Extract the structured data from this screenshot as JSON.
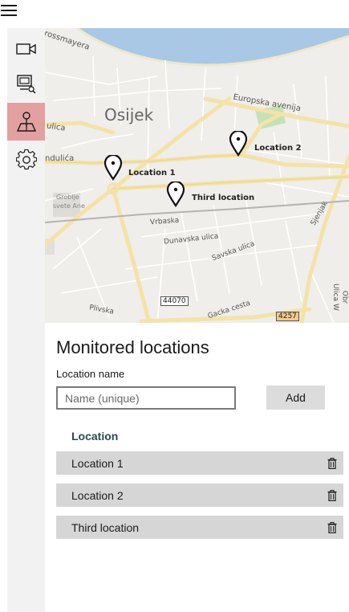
{
  "nav": {
    "items": [
      {
        "id": "cameras",
        "icon": "video-camera-icon",
        "selected": false
      },
      {
        "id": "monitor-search",
        "icon": "monitor-search-icon",
        "selected": false
      },
      {
        "id": "locations",
        "icon": "map-pin-icon",
        "selected": true
      },
      {
        "id": "settings",
        "icon": "gear-icon",
        "selected": false
      }
    ]
  },
  "map": {
    "labels": {
      "rossmayera": "rossmayera",
      "osijek": "Osijek",
      "europska": "Europska avenija",
      "ulica": "ulica",
      "ndulica": "ndulića",
      "groblje": "Groblje",
      "svete_ane": "svete Ane",
      "vrbaska": "Vrbaska",
      "dunavska": "Dunavska ulica",
      "savska": "Savska ulica",
      "sjenjak": "Sjenjak",
      "plivska": "Plivska",
      "gacka": "Gacka cesta",
      "ulica_w": "Ulica W",
      "obr": "Obr"
    },
    "shields": [
      "44070",
      "4257"
    ],
    "pins": [
      "Location 1",
      "Location 2",
      "Third location"
    ]
  },
  "monitored": {
    "title": "Monitored locations",
    "field_label": "Location name",
    "input_placeholder": "Name (unique)",
    "input_value": "",
    "add_label": "Add",
    "column_header": "Location",
    "locations": [
      {
        "name": "Location 1"
      },
      {
        "name": "Location 2"
      },
      {
        "name": "Third location"
      }
    ]
  },
  "colors": {
    "selected_nav": "#e3a0a0",
    "river": "#a9c8e6",
    "park": "#c5e2b6",
    "row_bg": "#d6d6d6",
    "header_text": "#2d4a4f"
  }
}
